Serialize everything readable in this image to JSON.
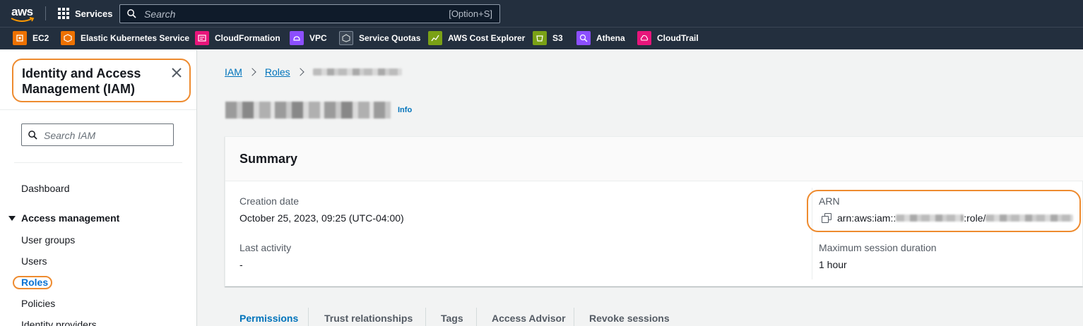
{
  "topnav": {
    "logo_text": "aws",
    "services_label": "Services",
    "search_placeholder": "Search",
    "search_shortcut": "[Option+S]"
  },
  "favorites": [
    {
      "label": "EC2",
      "icon": "ec2-icon",
      "color": "#ed7100"
    },
    {
      "label": "Elastic Kubernetes Service",
      "icon": "eks-icon",
      "color": "#ed7100"
    },
    {
      "label": "CloudFormation",
      "icon": "cloudformation-icon",
      "color": "#e7157b"
    },
    {
      "label": "VPC",
      "icon": "vpc-icon",
      "color": "#8c4fff"
    },
    {
      "label": "Service Quotas",
      "icon": "service-quotas-icon",
      "color": "#7d8998"
    },
    {
      "label": "AWS Cost Explorer",
      "icon": "cost-explorer-icon",
      "color": "#7aa116"
    },
    {
      "label": "S3",
      "icon": "s3-icon",
      "color": "#7aa116"
    },
    {
      "label": "Athena",
      "icon": "athena-icon",
      "color": "#8c4fff"
    },
    {
      "label": "CloudTrail",
      "icon": "cloudtrail-icon",
      "color": "#e7157b"
    }
  ],
  "sidebar": {
    "title": "Identity and Access Management (IAM)",
    "search_placeholder": "Search IAM",
    "dashboard": "Dashboard",
    "section": "Access management",
    "items": [
      "User groups",
      "Users",
      "Roles",
      "Policies",
      "Identity providers"
    ]
  },
  "breadcrumb": {
    "iam": "IAM",
    "roles": "Roles"
  },
  "page": {
    "info": "Info"
  },
  "summary": {
    "title": "Summary",
    "creation_date_label": "Creation date",
    "creation_date_value": "October 25, 2023, 09:25 (UTC-04:00)",
    "last_activity_label": "Last activity",
    "last_activity_value": "-",
    "arn_label": "ARN",
    "arn_prefix": "arn:aws:iam::",
    "arn_role": ":role/",
    "max_session_label": "Maximum session duration",
    "max_session_value": "1 hour"
  },
  "tabs": [
    "Permissions",
    "Trust relationships",
    "Tags",
    "Access Advisor",
    "Revoke sessions"
  ],
  "colors": {
    "accent": "#0073bb",
    "highlight": "#ee8b2f",
    "nav_bg": "#232f3e"
  }
}
